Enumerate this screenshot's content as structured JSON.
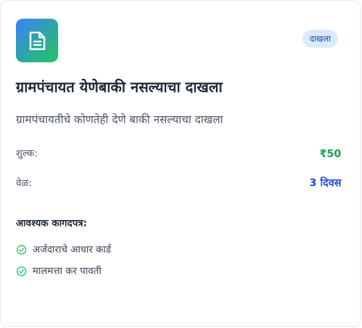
{
  "card": {
    "badge": "दाखला",
    "title": "ग्रामपंचायत येणेबाकी नसल्याचा दाखला",
    "description": "ग्रामपंचायतीचे कोणतेही देणे बाकी नसल्याचा दाखला",
    "fee": {
      "label": "शुल्क:",
      "value": "₹50"
    },
    "time": {
      "label": "वेळ:",
      "value": "3 दिवस"
    },
    "documents_heading": "आवश्यक कागदपत्र:",
    "documents": [
      "अर्जदाराचे आधार कार्ड",
      "मालमत्ता कर पावती"
    ]
  },
  "colors": {
    "icon_gradient_start": "#3b82f6",
    "icon_gradient_end": "#22c55e",
    "badge_bg": "#dbeafe",
    "fee": "#16a34a",
    "time": "#1d4ed8",
    "check": "#22c55e"
  },
  "icons": {
    "card_icon": "document-icon",
    "list_icon": "check-circle-icon"
  }
}
